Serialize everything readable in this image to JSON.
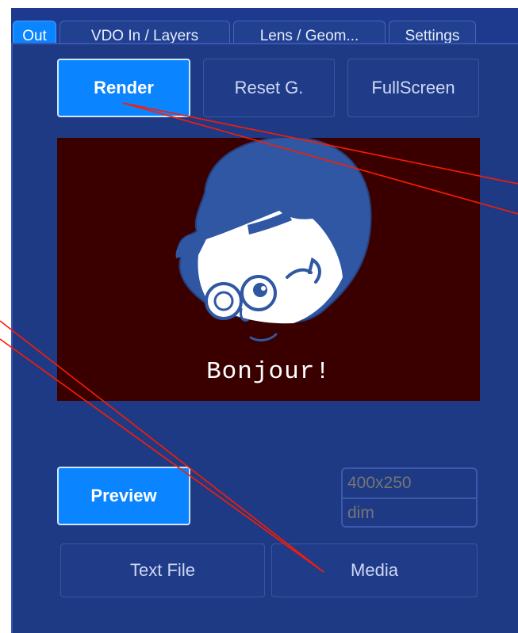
{
  "tabs": [
    {
      "label": "Out",
      "active": true
    },
    {
      "label": "VDO In / Layers",
      "active": false
    },
    {
      "label": "Lens / Geom...",
      "active": false
    },
    {
      "label": "Settings",
      "active": false
    }
  ],
  "toolbar": {
    "render_label": "Render",
    "reset_label": "Reset G.",
    "fullscreen_label": "FullScreen"
  },
  "preview": {
    "caption": "Bonjour!",
    "background": "#3a0000",
    "character_color": "#2f57a3"
  },
  "bottom": {
    "preview_label": "Preview",
    "resolution_placeholder": "400x250",
    "dim_placeholder": "dim",
    "textfile_label": "Text File",
    "media_label": "Media"
  },
  "colors": {
    "panel_background": "#1f3a84",
    "accent": "#0a84ff",
    "annotation_lines": "#ff1a00"
  }
}
